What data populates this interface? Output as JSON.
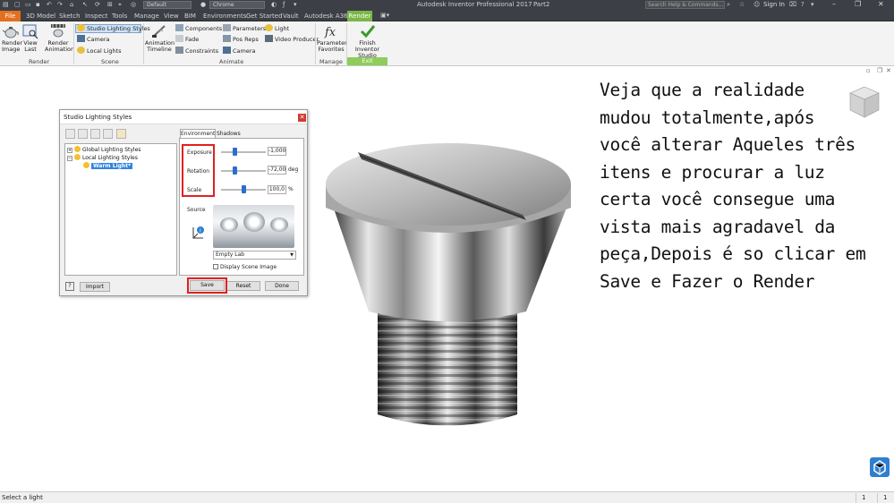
{
  "titlebar": {
    "style_box": "Default",
    "material_box": "Chrome",
    "app_title": "Autodesk Inventor Professional 2017",
    "doc_title": "Part2",
    "help_search_placeholder": "Search Help & Commands...",
    "sign_in": "Sign In"
  },
  "tabs": [
    "File",
    "3D Model",
    "Sketch",
    "Inspect",
    "Tools",
    "Manage",
    "View",
    "BIM",
    "Environments",
    "Get Started",
    "Vault",
    "Autodesk A360",
    "Render"
  ],
  "active_tab": "Render",
  "ribbon": {
    "render": {
      "render_image": [
        "Render",
        "Image"
      ],
      "view_last": [
        "View",
        "Last"
      ],
      "render_animation": [
        "Render",
        "Animation"
      ],
      "group_label": "Render"
    },
    "scene": {
      "studio_lighting_styles": "Studio Lighting Styles",
      "camera": "Camera",
      "local_lights": "Local Lights",
      "group_label": "Scene"
    },
    "animate": {
      "animation_timeline": [
        "Animation",
        "Timeline"
      ],
      "components": "Components",
      "fade": "Fade",
      "constraints": "Constraints",
      "parameters": "Parameters",
      "pos_reps": "Pos Reps",
      "camera": "Camera",
      "light": "Light",
      "video_producer": "Video Producer",
      "group_label": "Animate"
    },
    "manage": {
      "parameter_favorites": [
        "Parameter",
        "Favorites"
      ],
      "group_label": "Manage"
    },
    "exit": {
      "finish": [
        "Finish",
        "Inventor Studio"
      ],
      "group_label": "Exit"
    }
  },
  "dialog": {
    "title": "Studio Lighting Styles",
    "tree": {
      "global": "Global Lighting Styles",
      "local": "Local Lighting Styles",
      "selected": "Warm Light*"
    },
    "tabs": {
      "environment": "Environment",
      "shadows": "Shadows"
    },
    "exposure": {
      "label": "Exposure",
      "value": "-1,000",
      "fraction": 0.3
    },
    "rotation": {
      "label": "Rotation",
      "value": "-72,00",
      "unit": "deg",
      "fraction": 0.3
    },
    "scale": {
      "label": "Scale",
      "value": "100,0",
      "unit": "%",
      "fraction": 0.5
    },
    "source_label": "Source",
    "source_select": "Empty Lab",
    "display_scene_image": "Display Scene Image",
    "buttons": {
      "import": "Import",
      "save": "Save",
      "reset": "Reset",
      "done": "Done"
    }
  },
  "note_lines": [
    "Veja que a realidade",
    "mudou totalmente,após",
    "você alterar Aqueles três",
    "itens e procurar a luz",
    "certa você consegue uma",
    "vista mais agradavel da",
    "peça,Depois é so clicar em",
    "Save e Fazer o Render"
  ],
  "status": {
    "message": "Select a light",
    "count1": "1",
    "count2": "1"
  },
  "colors": {
    "file_tab": "#e46f1f",
    "render_tab": "#7ab648",
    "highlight": "#e02020",
    "selection": "#3383e0"
  }
}
